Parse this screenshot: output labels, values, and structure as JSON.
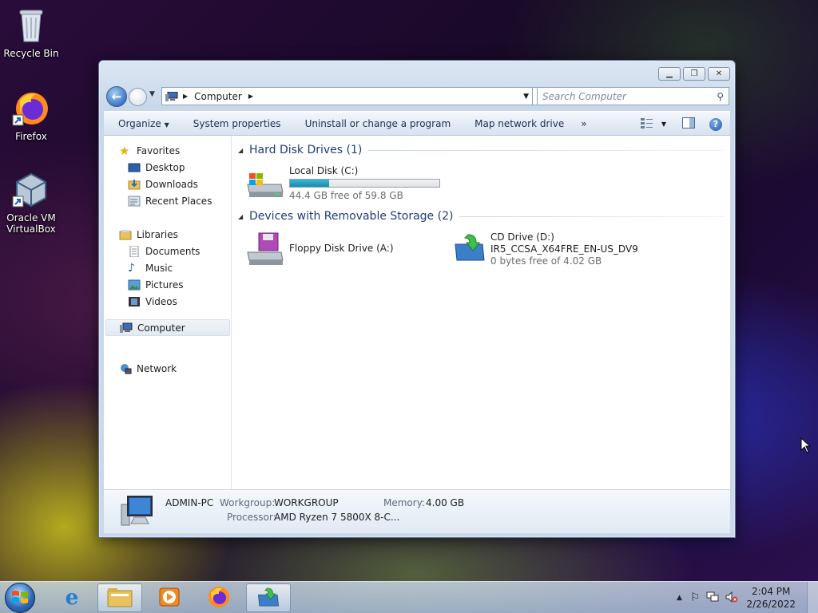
{
  "desktop": {
    "icons": [
      {
        "label": "Recycle Bin",
        "icon": "recycle-bin-icon"
      },
      {
        "label": "Firefox",
        "icon": "firefox-icon"
      },
      {
        "label": "Oracle VM VirtualBox",
        "icon": "virtualbox-icon"
      }
    ]
  },
  "window": {
    "address": {
      "segment": "Computer",
      "icon": "computer-icon"
    },
    "search_placeholder": "Search Computer",
    "toolbar": {
      "organize": "Organize",
      "system_properties": "System properties",
      "uninstall": "Uninstall or change a program",
      "map_drive": "Map network drive",
      "more": "»"
    },
    "nav": {
      "favorites": "Favorites",
      "desktop": "Desktop",
      "downloads": "Downloads",
      "recent": "Recent Places",
      "libraries": "Libraries",
      "documents": "Documents",
      "music": "Music",
      "pictures": "Pictures",
      "videos": "Videos",
      "computer": "Computer",
      "network": "Network"
    },
    "groups": {
      "hdd": "Hard Disk Drives (1)",
      "removable": "Devices with Removable Storage (2)"
    },
    "drives": {
      "c": {
        "name": "Local Disk (C:)",
        "free": "44.4 GB free of 59.8 GB",
        "used_fraction": 0.26
      },
      "a": {
        "name": "Floppy Disk Drive (A:)"
      },
      "d": {
        "name": "CD Drive (D:)",
        "label": "IR5_CCSA_X64FRE_EN-US_DV9",
        "free": "0 bytes free of 4.02 GB"
      }
    },
    "details": {
      "pc_name": "ADMIN-PC",
      "workgroup_label": "Workgroup:",
      "workgroup": "WORKGROUP",
      "memory_label": "Memory:",
      "memory": "4.00 GB",
      "processor_label": "Processor:",
      "processor": "AMD Ryzen 7 5800X 8-C..."
    }
  },
  "taskbar": {
    "time": "2:04 PM",
    "date": "2/26/2022"
  },
  "colors": {
    "accent": "#1e3d7a",
    "bar_fill": "#26a3c6"
  }
}
